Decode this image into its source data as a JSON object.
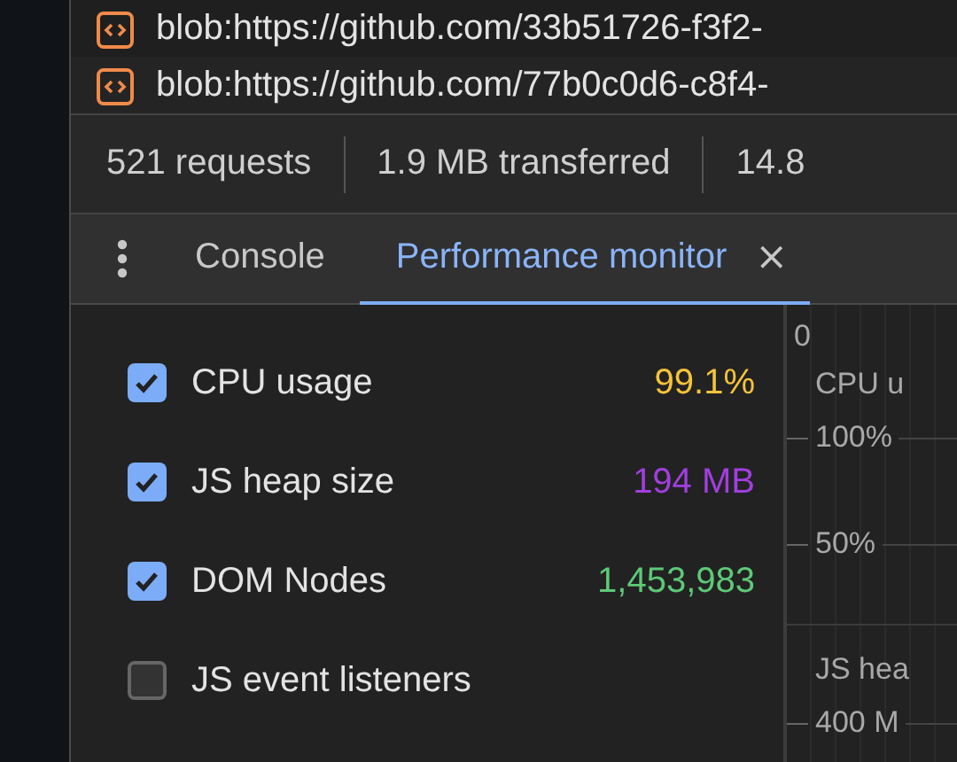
{
  "requests": [
    {
      "name": "blob:https://github.com/33b51726-f3f2-"
    },
    {
      "name": "blob:https://github.com/77b0c0d6-c8f4-"
    }
  ],
  "summary": [
    "521 requests",
    "1.9 MB transferred",
    "14.8"
  ],
  "tabs": [
    {
      "label": "Console",
      "selected": false
    },
    {
      "label": "Performance monitor",
      "selected": true
    }
  ],
  "close": "×",
  "metrics": [
    {
      "label": "CPU usage",
      "checked": true,
      "value": "99.1%",
      "color": "#f5c33b"
    },
    {
      "label": "JS heap size",
      "checked": true,
      "value": "194 MB",
      "color": "#a23ee0"
    },
    {
      "label": "DOM Nodes",
      "checked": true,
      "value": "1,453,983",
      "color": "#5dc977"
    },
    {
      "label": "JS event listeners",
      "checked": false
    }
  ],
  "graph": {
    "top_label": "0",
    "charts": [
      {
        "title": "CPU u",
        "ticks": [
          "100%",
          "50%"
        ]
      },
      {
        "title": "JS hea",
        "ticks": [
          "400 M"
        ]
      }
    ]
  }
}
